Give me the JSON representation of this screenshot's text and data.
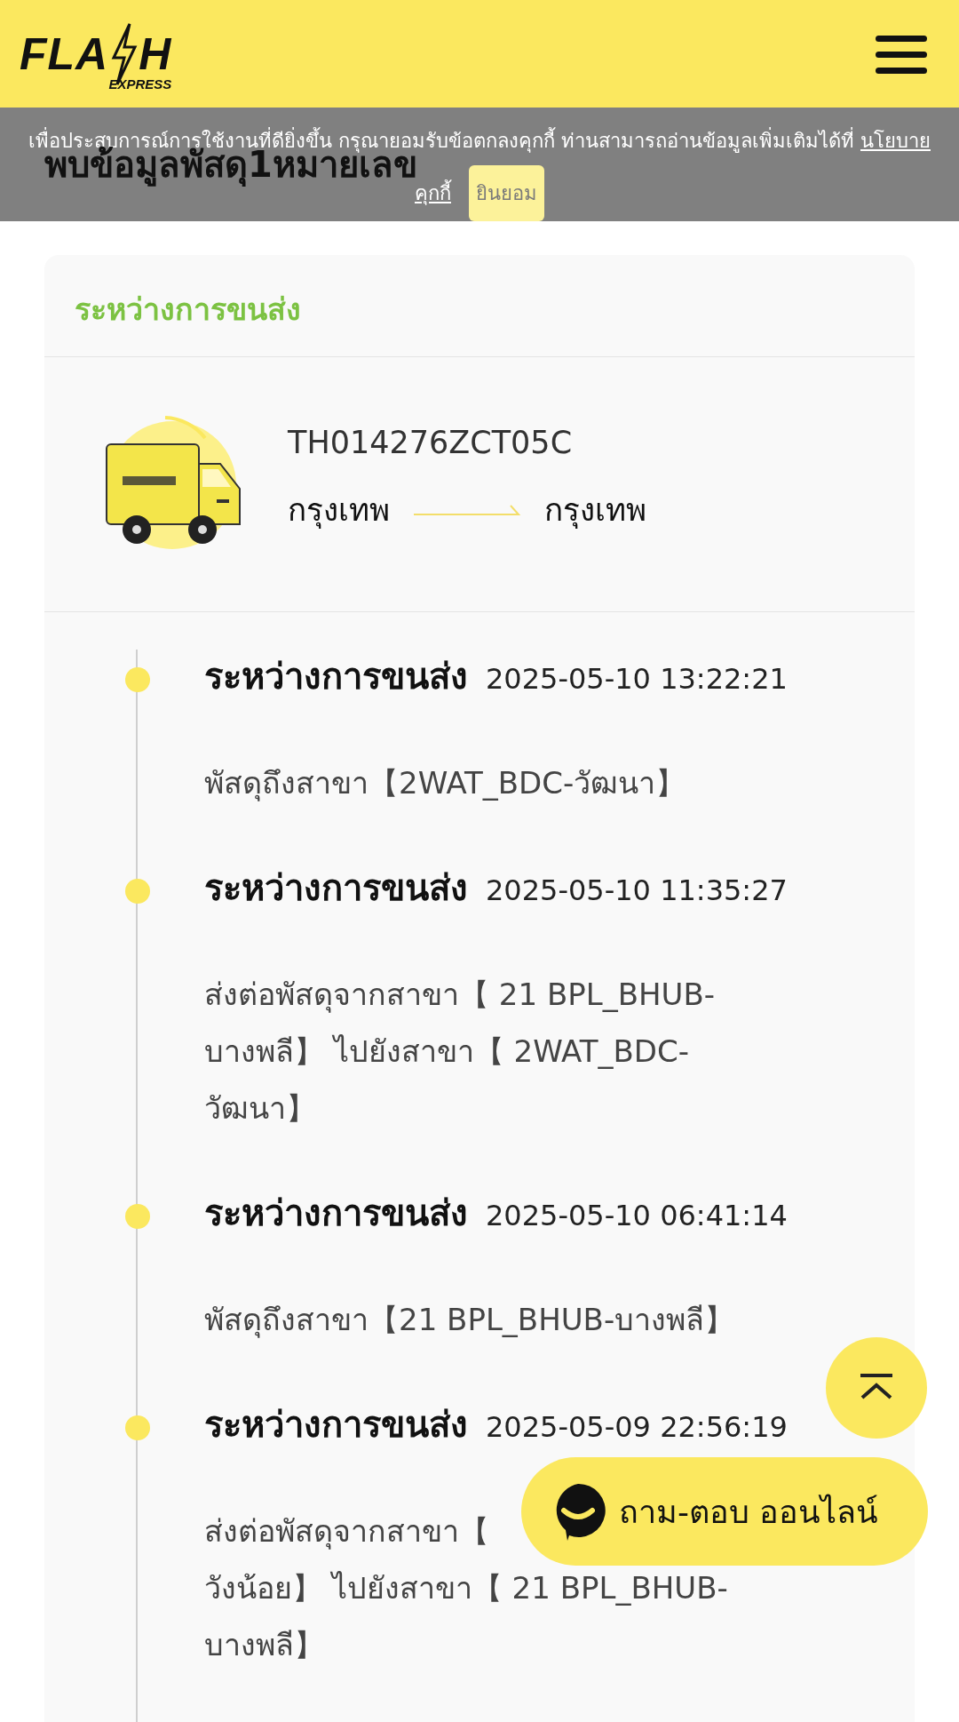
{
  "header": {
    "logo": {
      "left": "FLA",
      "right": "H",
      "sub": "EXPRESS"
    }
  },
  "cookie_banner": {
    "message": "เพื่อประสบการณ์การใช้งานที่ดียิ่งขึ้น กรุณายอมรับข้อตกลงคุกกี้ ท่านสามารถอ่านข้อมูลเพิ่มเติมได้ที่",
    "policy_link": [
      "นโยบาย",
      "คุกกี้"
    ],
    "accept_button": "ยินยอม"
  },
  "page_title": "พบข้อมูลพัสดุ1หมายเลข",
  "parcel": {
    "status": "ระหว่างการขนส่ง",
    "tracking_number": "TH014276ZCT05C",
    "origin": "กรุงเทพ",
    "destination": "กรุงเทพ"
  },
  "events": [
    {
      "status": "ระหว่างการขนส่ง",
      "time": "2025-05-10 13:22:21",
      "lines": [
        "พัสดุถึงสาขา【2WAT_BDC-วัฒนา】"
      ]
    },
    {
      "status": "ระหว่างการขนส่ง",
      "time": "2025-05-10 11:35:27",
      "lines": [
        "ส่งต่อพัสดุจากสาขา【 21 BPL_BHUB-",
        "บางพลี】 ไปยังสาขา【 2WAT_BDC-",
        "วัฒนา】"
      ]
    },
    {
      "status": "ระหว่างการขนส่ง",
      "time": "2025-05-10 06:41:14",
      "lines": [
        "พัสดุถึงสาขา【21 BPL_BHUB-บางพลี】"
      ]
    },
    {
      "status": "ระหว่างการขนส่ง",
      "time": "2025-05-09 22:56:19",
      "lines": [
        "ส่งต่อพัสดุจากสาขา【",
        "วังน้อย】 ไปยังสาขา【 21 BPL_BHUB-",
        "บางพลี】"
      ]
    }
  ],
  "chat_button": {
    "label": "ถาม-ตอบ ออนไลน์"
  }
}
